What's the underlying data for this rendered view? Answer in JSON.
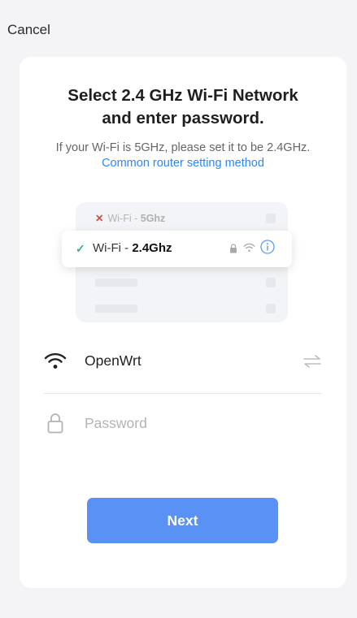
{
  "header": {
    "cancel_label": "Cancel"
  },
  "card": {
    "title_line1": "Select 2.4 GHz Wi-Fi Network",
    "title_line2": "and enter password.",
    "subtitle_text": "If your Wi-Fi is 5GHz, please set it to be 2.4GHz.",
    "subtitle_link": "Common router setting method"
  },
  "illustration": {
    "row_5g_prefix": "Wi-Fi - ",
    "row_5g_band": "5Ghz",
    "row_24_prefix": "Wi-Fi - ",
    "row_24_band": "2.4Ghz"
  },
  "form": {
    "ssid_value": "OpenWrt",
    "password_placeholder": "Password",
    "next_label": "Next"
  },
  "colors": {
    "accent": "#2f86f6",
    "button": "#5a91f5",
    "error": "#e8453c",
    "success": "#2fb68e"
  },
  "icons": [
    "wifi-icon",
    "lock-icon",
    "switch-network-icon",
    "info-icon",
    "check-icon",
    "x-icon"
  ]
}
